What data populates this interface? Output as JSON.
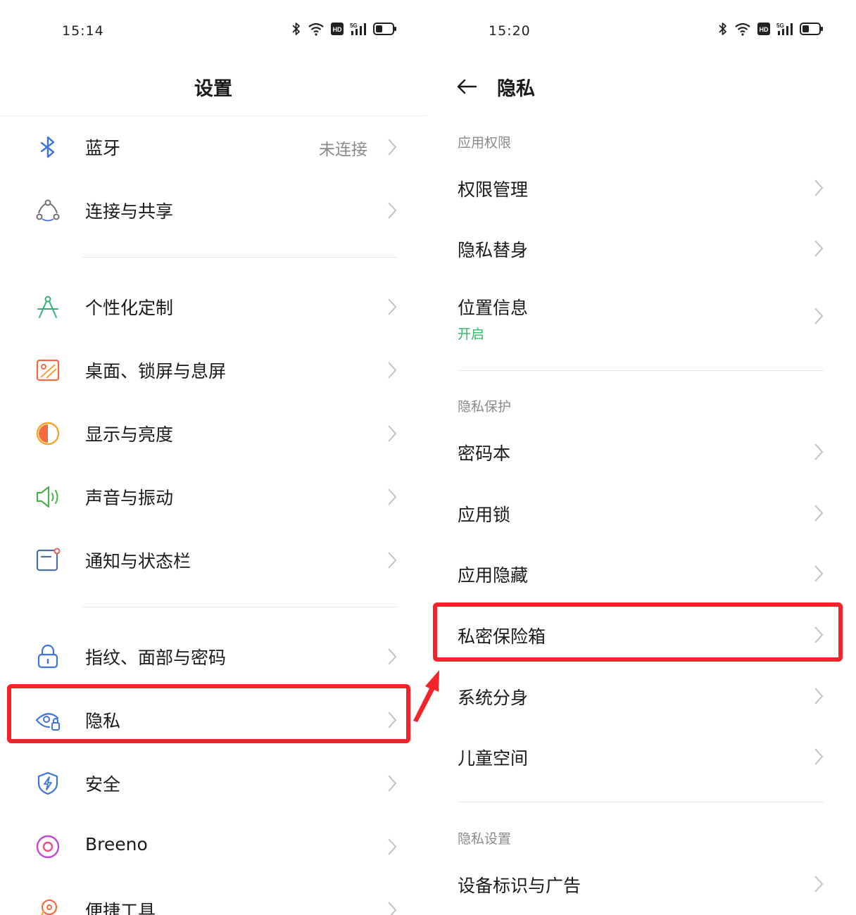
{
  "left": {
    "status": {
      "time": "15:14"
    },
    "title": "设置",
    "items": [
      {
        "label": "蓝牙",
        "value": "未连接",
        "icon": "bluetooth-icon"
      },
      {
        "label": "连接与共享",
        "icon": "share-icon"
      },
      {
        "label": "个性化定制",
        "icon": "compass-icon"
      },
      {
        "label": "桌面、锁屏与息屏",
        "icon": "wallpaper-icon"
      },
      {
        "label": "显示与亮度",
        "icon": "brightness-icon"
      },
      {
        "label": "声音与振动",
        "icon": "speaker-icon"
      },
      {
        "label": "通知与状态栏",
        "icon": "notification-icon"
      },
      {
        "label": "指纹、面部与密码",
        "icon": "lock-icon"
      },
      {
        "label": "隐私",
        "icon": "privacy-eye-icon"
      },
      {
        "label": "安全",
        "icon": "shield-icon"
      },
      {
        "label": "Breeno",
        "icon": "breeno-icon"
      },
      {
        "label": "便捷工具",
        "icon": "tools-icon"
      }
    ]
  },
  "right": {
    "status": {
      "time": "15:20"
    },
    "title": "隐私",
    "sections": {
      "app_permissions": "应用权限",
      "privacy_protection": "隐私保护",
      "privacy_settings": "隐私设置"
    },
    "items": {
      "permission_management": "权限管理",
      "privacy_substitute": "隐私替身",
      "location": "位置信息",
      "location_status": "开启",
      "password_book": "密码本",
      "app_lock": "应用锁",
      "app_hide": "应用隐藏",
      "private_safe": "私密保险箱",
      "system_clone": "系统分身",
      "kids_space": "儿童空间",
      "device_id_ads": "设备标识与广告"
    }
  },
  "colors": {
    "highlight": "#f5242a",
    "accent_green": "#35b96a",
    "text_primary": "#1a1a1a",
    "text_secondary": "#8a8a8a"
  }
}
